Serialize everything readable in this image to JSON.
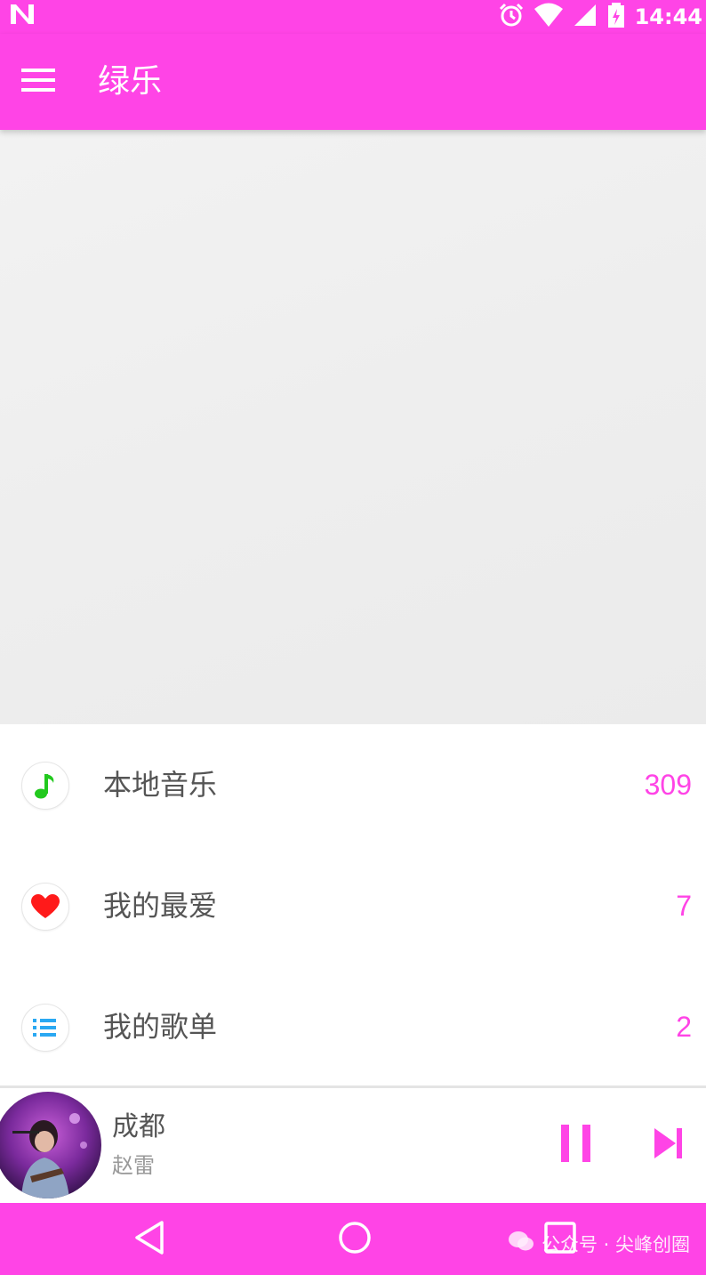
{
  "status_bar": {
    "time": "14:44"
  },
  "app_bar": {
    "title": "绿乐"
  },
  "menu": {
    "items": [
      {
        "label": "本地音乐",
        "count": "309",
        "icon": "music-note-icon"
      },
      {
        "label": "我的最爱",
        "count": "7",
        "icon": "heart-icon"
      },
      {
        "label": "我的歌单",
        "count": "2",
        "icon": "list-icon"
      }
    ]
  },
  "player": {
    "song": "成都",
    "artist": "赵雷"
  },
  "watermark": {
    "text": "公众号 · 尖峰创圈"
  },
  "colors": {
    "accent": "#ff44e6",
    "note_green": "#22c91e",
    "heart_red": "#ff1a1a",
    "list_blue": "#2aa8f2"
  }
}
